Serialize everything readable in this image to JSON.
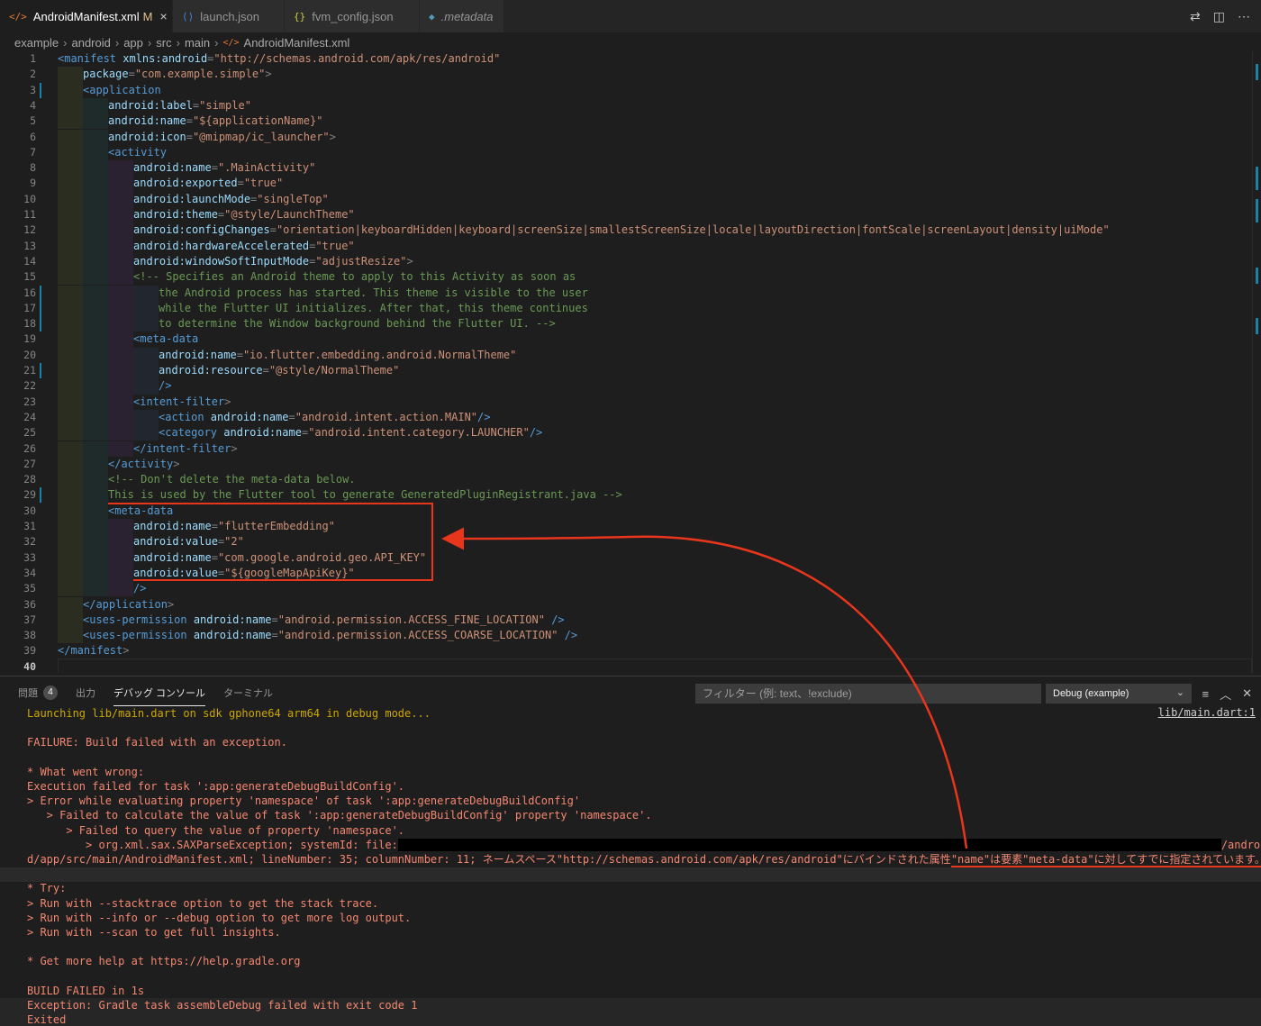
{
  "tabs": [
    {
      "icon": "</>",
      "label": "AndroidManifest.xml",
      "modified": "M",
      "close": "×",
      "active": true,
      "italic": false,
      "icon_color": "#e37933"
    },
    {
      "icon": "⟨⟩",
      "label": "launch.json",
      "active": false,
      "italic": false,
      "icon_color": "#3c8ce6"
    },
    {
      "icon": "{}",
      "label": "fvm_config.json",
      "active": false,
      "italic": false,
      "icon_color": "#cbcb41"
    },
    {
      "icon": "◆",
      "label": ".metadata",
      "active": false,
      "italic": true,
      "icon_color": "#519aba"
    }
  ],
  "breadcrumb": [
    "example",
    "android",
    "app",
    "src",
    "main",
    "AndroidManifest.xml"
  ],
  "code_lines": [
    {
      "n": "1",
      "d": 0,
      "s": [
        [
          "tag",
          "<manifest "
        ],
        [
          "attr",
          "xmlns:android"
        ],
        [
          "pun",
          "="
        ],
        [
          "str",
          "\"http://schemas.android.com/apk/res/android\""
        ]
      ]
    },
    {
      "n": "2",
      "d": 1,
      "s": [
        [
          "attr",
          "package"
        ],
        [
          "pun",
          "="
        ],
        [
          "str",
          "\"com.example.simple\""
        ],
        [
          "pun",
          ">"
        ]
      ]
    },
    {
      "n": "3",
      "d": 1,
      "s": [
        [
          "tag",
          "<application"
        ]
      ]
    },
    {
      "n": "4",
      "d": 2,
      "s": [
        [
          "attr",
          "android:label"
        ],
        [
          "pun",
          "="
        ],
        [
          "str",
          "\"simple\""
        ]
      ]
    },
    {
      "n": "5",
      "d": 2,
      "s": [
        [
          "attr",
          "android:name"
        ],
        [
          "pun",
          "="
        ],
        [
          "str",
          "\"${applicationName}\""
        ]
      ]
    },
    {
      "n": "6",
      "d": 2,
      "s": [
        [
          "attr",
          "android:icon"
        ],
        [
          "pun",
          "="
        ],
        [
          "str",
          "\"@mipmap/ic_launcher\""
        ],
        [
          "pun",
          ">"
        ]
      ]
    },
    {
      "n": "7",
      "d": 2,
      "s": [
        [
          "tag",
          "<activity"
        ]
      ]
    },
    {
      "n": "8",
      "d": 3,
      "s": [
        [
          "attr",
          "android:name"
        ],
        [
          "pun",
          "="
        ],
        [
          "str",
          "\".MainActivity\""
        ]
      ]
    },
    {
      "n": "9",
      "d": 3,
      "s": [
        [
          "attr",
          "android:exported"
        ],
        [
          "pun",
          "="
        ],
        [
          "str",
          "\"true\""
        ]
      ]
    },
    {
      "n": "10",
      "d": 3,
      "s": [
        [
          "attr",
          "android:launchMode"
        ],
        [
          "pun",
          "="
        ],
        [
          "str",
          "\"singleTop\""
        ]
      ]
    },
    {
      "n": "11",
      "d": 3,
      "s": [
        [
          "attr",
          "android:theme"
        ],
        [
          "pun",
          "="
        ],
        [
          "str",
          "\"@style/LaunchTheme\""
        ]
      ]
    },
    {
      "n": "12",
      "d": 3,
      "s": [
        [
          "attr",
          "android:configChanges"
        ],
        [
          "pun",
          "="
        ],
        [
          "str",
          "\"orientation|keyboardHidden|keyboard|screenSize|smallestScreenSize|locale|layoutDirection|fontScale|screenLayout|density|uiMode\""
        ]
      ]
    },
    {
      "n": "13",
      "d": 3,
      "s": [
        [
          "attr",
          "android:hardwareAccelerated"
        ],
        [
          "pun",
          "="
        ],
        [
          "str",
          "\"true\""
        ]
      ]
    },
    {
      "n": "14",
      "d": 3,
      "s": [
        [
          "attr",
          "android:windowSoftInputMode"
        ],
        [
          "pun",
          "="
        ],
        [
          "str",
          "\"adjustResize\""
        ],
        [
          "pun",
          ">"
        ]
      ]
    },
    {
      "n": "15",
      "d": 3,
      "s": [
        [
          "cmt",
          "<!-- Specifies an Android theme to apply to this Activity as soon as"
        ]
      ]
    },
    {
      "n": "16",
      "d": 4,
      "s": [
        [
          "cmt",
          "the Android process has started. This theme is visible to the user"
        ]
      ]
    },
    {
      "n": "17",
      "d": 4,
      "s": [
        [
          "cmt",
          "while the Flutter UI initializes. After that, this theme continues"
        ]
      ]
    },
    {
      "n": "18",
      "d": 4,
      "s": [
        [
          "cmt",
          "to determine the Window background behind the Flutter UI. -->"
        ]
      ]
    },
    {
      "n": "19",
      "d": 3,
      "s": [
        [
          "tag",
          "<meta-data"
        ]
      ]
    },
    {
      "n": "20",
      "d": 4,
      "s": [
        [
          "attr",
          "android:name"
        ],
        [
          "pun",
          "="
        ],
        [
          "str",
          "\"io.flutter.embedding.android.NormalTheme\""
        ]
      ]
    },
    {
      "n": "21",
      "d": 4,
      "s": [
        [
          "attr",
          "android:resource"
        ],
        [
          "pun",
          "="
        ],
        [
          "str",
          "\"@style/NormalTheme\""
        ]
      ]
    },
    {
      "n": "22",
      "d": 4,
      "s": [
        [
          "tag",
          "/>"
        ]
      ]
    },
    {
      "n": "23",
      "d": 3,
      "s": [
        [
          "tag",
          "<intent-filter"
        ],
        [
          "pun",
          ">"
        ]
      ]
    },
    {
      "n": "24",
      "d": 4,
      "s": [
        [
          "tag",
          "<action "
        ],
        [
          "attr",
          "android:name"
        ],
        [
          "pun",
          "="
        ],
        [
          "str",
          "\"android.intent.action.MAIN\""
        ],
        [
          "tag",
          "/>"
        ]
      ]
    },
    {
      "n": "25",
      "d": 4,
      "s": [
        [
          "tag",
          "<category "
        ],
        [
          "attr",
          "android:name"
        ],
        [
          "pun",
          "="
        ],
        [
          "str",
          "\"android.intent.category.LAUNCHER\""
        ],
        [
          "tag",
          "/>"
        ]
      ]
    },
    {
      "n": "26",
      "d": 3,
      "s": [
        [
          "tag",
          "</intent-filter"
        ],
        [
          "pun",
          ">"
        ]
      ]
    },
    {
      "n": "27",
      "d": 2,
      "s": [
        [
          "tag",
          "</activity"
        ],
        [
          "pun",
          ">"
        ]
      ]
    },
    {
      "n": "28",
      "d": 2,
      "s": [
        [
          "cmt",
          "<!-- Don't delete the meta-data below."
        ]
      ]
    },
    {
      "n": "29",
      "d": 2,
      "s": [
        [
          "cmt",
          "This is used by the Flutter tool to generate GeneratedPluginRegistrant.java -->"
        ]
      ]
    },
    {
      "n": "30",
      "d": 2,
      "s": [
        [
          "tag",
          "<meta-data"
        ]
      ]
    },
    {
      "n": "31",
      "d": 3,
      "s": [
        [
          "attr",
          "android:name"
        ],
        [
          "pun",
          "="
        ],
        [
          "str",
          "\"flutterEmbedding\""
        ]
      ]
    },
    {
      "n": "32",
      "d": 3,
      "s": [
        [
          "attr",
          "android:value"
        ],
        [
          "pun",
          "="
        ],
        [
          "str",
          "\"2\""
        ]
      ]
    },
    {
      "n": "33",
      "d": 3,
      "s": [
        [
          "attr",
          "android:name"
        ],
        [
          "pun",
          "="
        ],
        [
          "str",
          "\"com.google.android.geo.API_KEY\""
        ]
      ]
    },
    {
      "n": "34",
      "d": 3,
      "s": [
        [
          "attr",
          "android:value"
        ],
        [
          "pun",
          "="
        ],
        [
          "str",
          "\"${googleMapApiKey}\""
        ]
      ]
    },
    {
      "n": "35",
      "d": 3,
      "s": [
        [
          "tag",
          "/>"
        ]
      ]
    },
    {
      "n": "36",
      "d": 1,
      "s": [
        [
          "tag",
          "</application"
        ],
        [
          "pun",
          ">"
        ]
      ]
    },
    {
      "n": "37",
      "d": 1,
      "s": [
        [
          "tag",
          "<uses-permission "
        ],
        [
          "attr",
          "android:name"
        ],
        [
          "pun",
          "="
        ],
        [
          "str",
          "\"android.permission.ACCESS_FINE_LOCATION\""
        ],
        [
          "tag",
          " />"
        ]
      ]
    },
    {
      "n": "38",
      "d": 1,
      "s": [
        [
          "tag",
          "<uses-permission "
        ],
        [
          "attr",
          "android:name"
        ],
        [
          "pun",
          "="
        ],
        [
          "str",
          "\"android.permission.ACCESS_COARSE_LOCATION\""
        ],
        [
          "tag",
          " />"
        ]
      ]
    },
    {
      "n": "39",
      "d": 0,
      "s": [
        [
          "tag",
          "</manifest"
        ],
        [
          "pun",
          ">"
        ]
      ]
    },
    {
      "n": "40",
      "d": 0,
      "s": []
    }
  ],
  "current_line": "40",
  "panel": {
    "tabs": [
      {
        "label": "問題",
        "badge": "4",
        "active": false
      },
      {
        "label": "出力",
        "active": false
      },
      {
        "label": "デバッグ コンソール",
        "active": true
      },
      {
        "label": "ターミナル",
        "active": false
      }
    ],
    "filter_placeholder": "フィルター (例: text、!exclude)",
    "debug_config": "Debug (example)",
    "source_link": "lib/main.dart:1"
  },
  "console_lines": [
    {
      "text": "Launching lib/main.dart on sdk gphone64 arm64 in debug mode...",
      "kind": "warn"
    },
    {
      "text": "",
      "kind": "err"
    },
    {
      "text": "FAILURE: Build failed with an exception.",
      "kind": "err"
    },
    {
      "text": "",
      "kind": "err"
    },
    {
      "text": "* What went wrong:",
      "kind": "err"
    },
    {
      "text": "Execution failed for task ':app:generateDebugBuildConfig'.",
      "kind": "err"
    },
    {
      "text": "> Error while evaluating property 'namespace' of task ':app:generateDebugBuildConfig'",
      "kind": "err"
    },
    {
      "text": "   > Failed to calculate the value of task ':app:generateDebugBuildConfig' property 'namespace'.",
      "kind": "err"
    },
    {
      "text": "      > Failed to query the value of property 'namespace'.",
      "kind": "err"
    },
    {
      "text": "         > org.xml.sax.SAXParseException; systemId: file:",
      "tail": "/androi",
      "kind": "err",
      "redacted": true
    },
    {
      "text": "d/app/src/main/AndroidManifest.xml; lineNumber: 35; columnNumber: 11; ネームスペース\"http://schemas.android.com/apk/res/android\"にバインドされた属性",
      "underlined": "\"name\"は要素\"meta-data\"に対してすでに指定されています。",
      "kind": "err"
    },
    {
      "text": "",
      "kind": "err"
    },
    {
      "text": "* Try:",
      "kind": "err"
    },
    {
      "text": "> Run with --stacktrace option to get the stack trace.",
      "kind": "err"
    },
    {
      "text": "> Run with --info or --debug option to get more log output.",
      "kind": "err"
    },
    {
      "text": "> Run with --scan to get full insights.",
      "kind": "err"
    },
    {
      "text": "",
      "kind": "err"
    },
    {
      "text": "* Get more help at https://help.gradle.org",
      "kind": "err"
    },
    {
      "text": "",
      "kind": "err"
    },
    {
      "text": "BUILD FAILED in 1s",
      "kind": "err"
    },
    {
      "text": "Exception: Gradle task assembleDebug failed with exit code 1",
      "kind": "err"
    },
    {
      "text": "Exited",
      "kind": "err"
    }
  ],
  "colors": {
    "annotation": "#e8361c",
    "git_marker": "#1b81a8"
  }
}
